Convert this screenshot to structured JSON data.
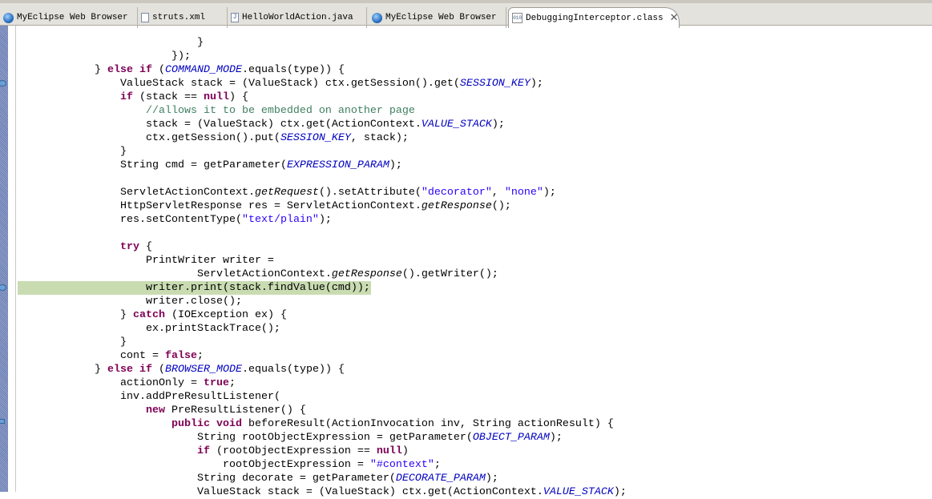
{
  "tabs": [
    {
      "label": "MyEclipse Web Browser",
      "icon": "globe-icon",
      "active": false
    },
    {
      "label": "struts.xml",
      "icon": "xml-file-icon",
      "active": false
    },
    {
      "label": "HelloWorldAction.java",
      "icon": "java-file-icon",
      "active": false
    },
    {
      "label": "MyEclipse Web Browser",
      "icon": "globe-icon",
      "active": false
    },
    {
      "label": "DebuggingInterceptor.class",
      "icon": "class-file-icon",
      "active": true,
      "close": "✕"
    }
  ],
  "colors": {
    "keyword": "#7f0055",
    "comment": "#3f7f5f",
    "string": "#2a00ff",
    "field": "#0000c0",
    "highlight": "#c9dcb1"
  },
  "highlighted_line": 18,
  "code": [
    {
      "indent": 28,
      "tokens": [
        [
          "p",
          "}"
        ]
      ]
    },
    {
      "indent": 24,
      "tokens": [
        [
          "p",
          "});"
        ]
      ]
    },
    {
      "indent": 12,
      "tokens": [
        [
          "p",
          "} "
        ],
        [
          "k",
          "else if"
        ],
        [
          "p",
          " ("
        ],
        [
          "f",
          "COMMAND_MODE"
        ],
        [
          "p",
          ".equals(type)) {"
        ]
      ]
    },
    {
      "indent": 16,
      "tokens": [
        [
          "p",
          "ValueStack stack = (ValueStack) ctx.getSession().get("
        ],
        [
          "f",
          "SESSION_KEY"
        ],
        [
          "p",
          ");"
        ]
      ]
    },
    {
      "indent": 16,
      "tokens": [
        [
          "k",
          "if"
        ],
        [
          "p",
          " (stack == "
        ],
        [
          "k",
          "null"
        ],
        [
          "p",
          ") {"
        ]
      ]
    },
    {
      "indent": 20,
      "tokens": [
        [
          "c",
          "//allows it to be embedded on another page"
        ]
      ]
    },
    {
      "indent": 20,
      "tokens": [
        [
          "p",
          "stack = (ValueStack) ctx.get(ActionContext."
        ],
        [
          "f",
          "VALUE_STACK"
        ],
        [
          "p",
          ");"
        ]
      ]
    },
    {
      "indent": 20,
      "tokens": [
        [
          "p",
          "ctx.getSession().put("
        ],
        [
          "f",
          "SESSION_KEY"
        ],
        [
          "p",
          ", stack);"
        ]
      ]
    },
    {
      "indent": 16,
      "tokens": [
        [
          "p",
          "}"
        ]
      ]
    },
    {
      "indent": 16,
      "tokens": [
        [
          "p",
          "String cmd = getParameter("
        ],
        [
          "f",
          "EXPRESSION_PARAM"
        ],
        [
          "p",
          ");"
        ]
      ]
    },
    {
      "indent": 0,
      "tokens": []
    },
    {
      "indent": 16,
      "tokens": [
        [
          "p",
          "ServletActionContext."
        ],
        [
          "m",
          "getRequest"
        ],
        [
          "p",
          "().setAttribute("
        ],
        [
          "s",
          "\"decorator\""
        ],
        [
          "p",
          ", "
        ],
        [
          "s",
          "\"none\""
        ],
        [
          "p",
          ");"
        ]
      ]
    },
    {
      "indent": 16,
      "tokens": [
        [
          "p",
          "HttpServletResponse res = ServletActionContext."
        ],
        [
          "m",
          "getResponse"
        ],
        [
          "p",
          "();"
        ]
      ]
    },
    {
      "indent": 16,
      "tokens": [
        [
          "p",
          "res.setContentType("
        ],
        [
          "s",
          "\"text/plain\""
        ],
        [
          "p",
          ");"
        ]
      ]
    },
    {
      "indent": 0,
      "tokens": []
    },
    {
      "indent": 16,
      "tokens": [
        [
          "k",
          "try"
        ],
        [
          "p",
          " {"
        ]
      ]
    },
    {
      "indent": 20,
      "tokens": [
        [
          "p",
          "PrintWriter writer ="
        ]
      ]
    },
    {
      "indent": 28,
      "tokens": [
        [
          "p",
          "ServletActionContext."
        ],
        [
          "m",
          "getResponse"
        ],
        [
          "p",
          "().getWriter();"
        ]
      ]
    },
    {
      "indent": 20,
      "tokens": [
        [
          "p",
          "writer.print(stack.findValue(cmd));"
        ]
      ]
    },
    {
      "indent": 20,
      "tokens": [
        [
          "p",
          "writer.close();"
        ]
      ]
    },
    {
      "indent": 16,
      "tokens": [
        [
          "p",
          "} "
        ],
        [
          "k",
          "catch"
        ],
        [
          "p",
          " (IOException ex) {"
        ]
      ]
    },
    {
      "indent": 20,
      "tokens": [
        [
          "p",
          "ex.printStackTrace();"
        ]
      ]
    },
    {
      "indent": 16,
      "tokens": [
        [
          "p",
          "}"
        ]
      ]
    },
    {
      "indent": 16,
      "tokens": [
        [
          "p",
          "cont = "
        ],
        [
          "k",
          "false"
        ],
        [
          "p",
          ";"
        ]
      ]
    },
    {
      "indent": 12,
      "tokens": [
        [
          "p",
          "} "
        ],
        [
          "k",
          "else if"
        ],
        [
          "p",
          " ("
        ],
        [
          "f",
          "BROWSER_MODE"
        ],
        [
          "p",
          ".equals(type)) {"
        ]
      ]
    },
    {
      "indent": 16,
      "tokens": [
        [
          "p",
          "actionOnly = "
        ],
        [
          "k",
          "true"
        ],
        [
          "p",
          ";"
        ]
      ]
    },
    {
      "indent": 16,
      "tokens": [
        [
          "p",
          "inv.addPreResultListener("
        ]
      ]
    },
    {
      "indent": 20,
      "tokens": [
        [
          "k",
          "new"
        ],
        [
          "p",
          " PreResultListener() {"
        ]
      ]
    },
    {
      "indent": 24,
      "tokens": [
        [
          "k",
          "public void"
        ],
        [
          "p",
          " beforeResult(ActionInvocation inv, String actionResult) {"
        ]
      ]
    },
    {
      "indent": 28,
      "tokens": [
        [
          "p",
          "String rootObjectExpression = getParameter("
        ],
        [
          "f",
          "OBJECT_PARAM"
        ],
        [
          "p",
          ");"
        ]
      ]
    },
    {
      "indent": 28,
      "tokens": [
        [
          "k",
          "if"
        ],
        [
          "p",
          " (rootObjectExpression == "
        ],
        [
          "k",
          "null"
        ],
        [
          "p",
          ")"
        ]
      ]
    },
    {
      "indent": 32,
      "tokens": [
        [
          "p",
          "rootObjectExpression = "
        ],
        [
          "s",
          "\"#context\""
        ],
        [
          "p",
          ";"
        ]
      ]
    },
    {
      "indent": 28,
      "tokens": [
        [
          "p",
          "String decorate = getParameter("
        ],
        [
          "f",
          "DECORATE_PARAM"
        ],
        [
          "p",
          ");"
        ]
      ]
    },
    {
      "indent": 28,
      "tokens": [
        [
          "p",
          "ValueStack stack = (ValueStack) ctx.get(ActionContext."
        ],
        [
          "f",
          "VALUE_STACK"
        ],
        [
          "p",
          ");"
        ]
      ]
    }
  ]
}
